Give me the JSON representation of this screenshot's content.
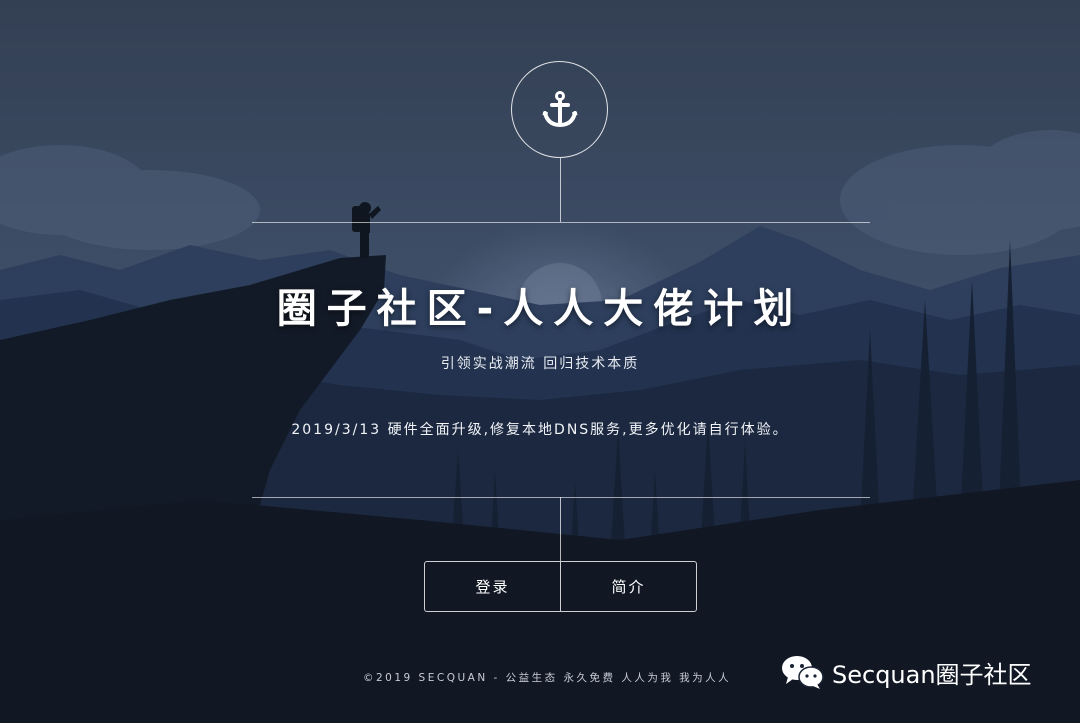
{
  "colors": {
    "sky_top": "#3d4c63",
    "sky_mid": "#4c5f7c",
    "mountain_far": "#2f4568",
    "mountain_mid": "#233654",
    "foreground": "#131a26",
    "text": "#ffffff"
  },
  "brand": {
    "logo_icon": "anchor-icon"
  },
  "hero": {
    "title": "圈子社区-人人大佬计划",
    "subtitle": "引领实战潮流 回归技术本质",
    "notice": "2019/3/13 硬件全面升级,修复本地DNS服务,更多优化请自行体验。"
  },
  "actions": {
    "login_label": "登录",
    "intro_label": "简介"
  },
  "footer": {
    "copyright": "©2019 SECQUAN - 公益生态 永久免费 人人为我 我为人人"
  },
  "watermark": {
    "icon": "wechat-icon",
    "text": "Secquan圈子社区"
  }
}
